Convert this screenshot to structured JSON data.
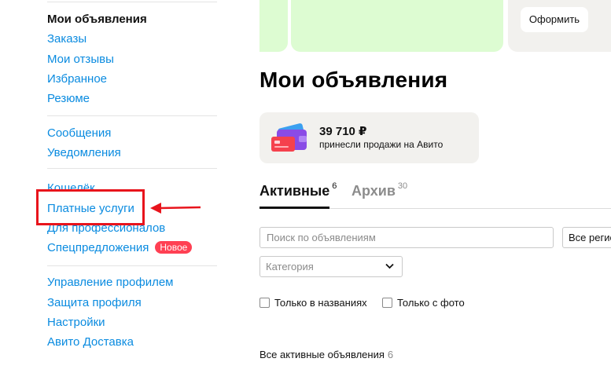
{
  "sidebar": {
    "current": "Мои объявления",
    "group1": [
      "Заказы",
      "Мои отзывы",
      "Избранное",
      "Резюме"
    ],
    "group2": [
      "Сообщения",
      "Уведомления"
    ],
    "group3": [
      "Кошелёк",
      "Платные услуги",
      "Для профессионалов",
      "Спецпредложения"
    ],
    "badge_new": "Новое",
    "group4": [
      "Управление профилем",
      "Защита профиля",
      "Настройки",
      "Авито Доставка"
    ]
  },
  "banner": {
    "button_label": "Оформить"
  },
  "main": {
    "title": "Мои объявления",
    "sales": {
      "amount": "39 710 ₽",
      "caption": "принесли продажи на Авито"
    },
    "tabs": [
      {
        "label": "Активные",
        "count": "6"
      },
      {
        "label": "Архив",
        "count": "30"
      }
    ],
    "search_placeholder": "Поиск по объявлениям",
    "region_value": "Все регионы",
    "category_placeholder": "Категория",
    "checkbox_names": "Только в названиях",
    "checkbox_photo": "Только с фото",
    "all_active_label": "Все активные объявления",
    "all_active_count": "6"
  },
  "colors": {
    "link": "#0a8be0",
    "annotation_red": "#e8141c",
    "badge_red": "#ff4053",
    "banner_green": "#ddfcd2",
    "card_beige": "#f2f1ee"
  },
  "icons": [
    "wallet-cards-icon",
    "chevron-down-icon",
    "annotation-arrow-icon"
  ]
}
